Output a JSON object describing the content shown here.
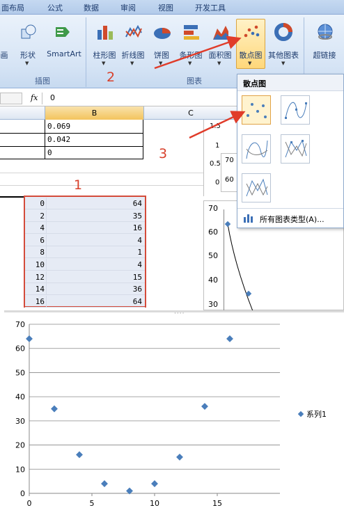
{
  "tabs": [
    "面布局",
    "公式",
    "数据",
    "审阅",
    "视图",
    "开发工具"
  ],
  "ribbon": {
    "illustrations": {
      "picture_label": "画",
      "shapes_label": "形状",
      "smartart_label": "SmartArt",
      "group_label": "插图"
    },
    "charts": {
      "column": "柱形图",
      "line": "折线图",
      "pie": "饼图",
      "bar": "条形图",
      "area": "面积图",
      "scatter": "散点图",
      "other": "其他图表",
      "group_label": "图表"
    },
    "links": {
      "hyperlink": "超链接"
    }
  },
  "formula_bar": {
    "fx": "fx",
    "value": "0"
  },
  "columns": [
    "B",
    "C"
  ],
  "upper_cells": [
    "0.069",
    "0.042",
    "0"
  ],
  "table": {
    "x": [
      "0",
      "2",
      "4",
      "6",
      "8",
      "10",
      "12",
      "14",
      "16"
    ],
    "y": [
      "64",
      "35",
      "16",
      "4",
      "1",
      "4",
      "15",
      "36",
      "64"
    ]
  },
  "annotations": {
    "one": "1",
    "two": "2",
    "three": "3"
  },
  "dropdown": {
    "title": "散点图",
    "all_types": "所有图表类型(A)..."
  },
  "bg_chart": {
    "small_ticks": [
      "1.5",
      "1",
      "0.5",
      "0"
    ],
    "mini_ticks": [
      "70",
      "60"
    ],
    "ticks": [
      "70",
      "60",
      "50",
      "40",
      "30"
    ]
  },
  "chart_data": {
    "type": "scatter",
    "x": [
      0,
      2,
      4,
      6,
      8,
      10,
      12,
      14,
      16
    ],
    "series": [
      {
        "name": "系列1",
        "values": [
          64,
          35,
          16,
          4,
          1,
          4,
          15,
          36,
          64
        ],
        "color": "#4a7ebb"
      }
    ],
    "xlim": [
      0,
      20
    ],
    "ylim": [
      0,
      70
    ],
    "xticks": [
      "0",
      "5",
      "10",
      "15"
    ],
    "yticks": [
      "0",
      "10",
      "20",
      "30",
      "40",
      "50",
      "60",
      "70"
    ],
    "grid": true,
    "legend": "right"
  }
}
